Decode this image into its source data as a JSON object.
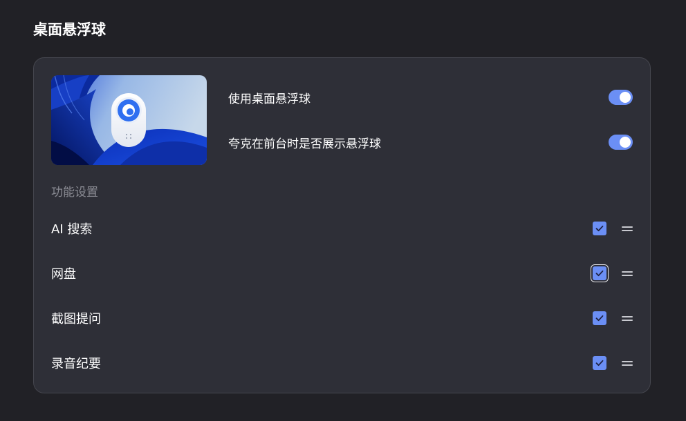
{
  "page": {
    "title": "桌面悬浮球"
  },
  "settings": {
    "toggles": [
      {
        "label": "使用桌面悬浮球",
        "enabled": true
      },
      {
        "label": "夸克在前台时是否展示悬浮球",
        "enabled": true
      }
    ]
  },
  "features": {
    "section_title": "功能设置",
    "items": [
      {
        "label": "AI 搜索",
        "checked": true
      },
      {
        "label": "网盘",
        "checked": true
      },
      {
        "label": "截图提问",
        "checked": true
      },
      {
        "label": "录音纪要",
        "checked": true
      }
    ]
  },
  "colors": {
    "background": "#212126",
    "card": "#2e2f37",
    "accent": "#6b8ff5",
    "muted_text": "#8a8b93"
  },
  "icons": {
    "checkbox": "check-icon",
    "reorder": "drag-handle-icon",
    "preview": "floating-ball-preview"
  }
}
